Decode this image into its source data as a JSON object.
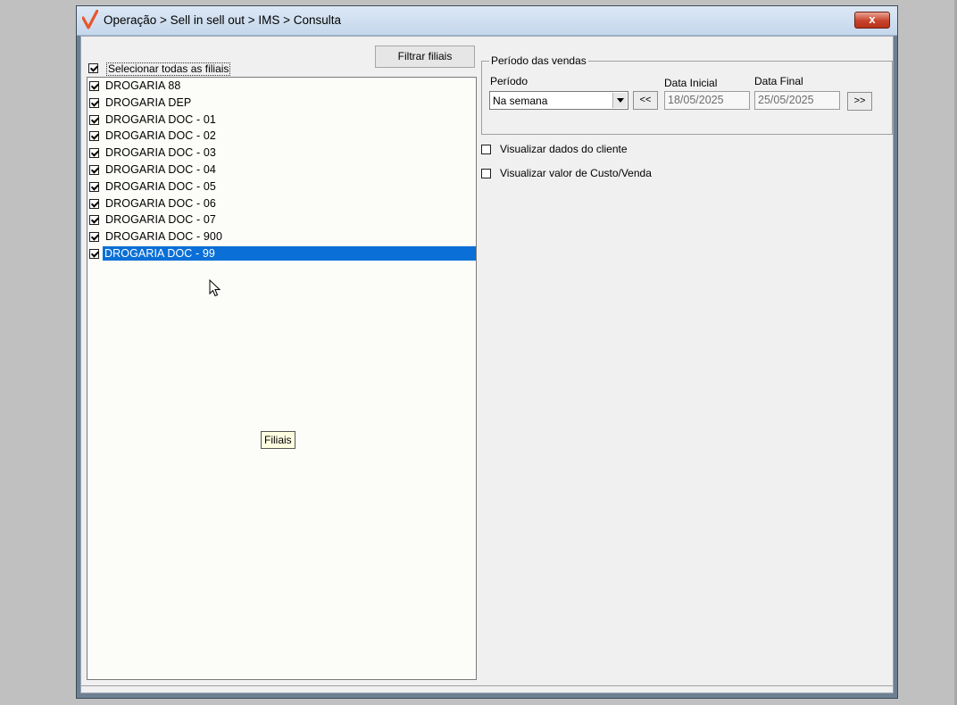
{
  "window": {
    "title": "Operação > Sell in sell out > IMS > Consulta",
    "close_label": "x"
  },
  "filiais": {
    "filter_button": "Filtrar filiais",
    "select_all_label": "Selecionar todas as filiais",
    "select_all_checked": true,
    "items": [
      {
        "label": "DROGARIA 88",
        "checked": true,
        "selected": false
      },
      {
        "label": "DROGARIA DEP",
        "checked": true,
        "selected": false
      },
      {
        "label": "DROGARIA DOC - 01",
        "checked": true,
        "selected": false
      },
      {
        "label": "DROGARIA DOC - 02",
        "checked": true,
        "selected": false
      },
      {
        "label": "DROGARIA DOC - 03",
        "checked": true,
        "selected": false
      },
      {
        "label": "DROGARIA DOC - 04",
        "checked": true,
        "selected": false
      },
      {
        "label": "DROGARIA DOC - 05",
        "checked": true,
        "selected": false
      },
      {
        "label": "DROGARIA DOC - 06",
        "checked": true,
        "selected": false
      },
      {
        "label": "DROGARIA DOC - 07",
        "checked": true,
        "selected": false
      },
      {
        "label": "DROGARIA DOC - 900",
        "checked": true,
        "selected": false
      },
      {
        "label": "DROGARIA DOC - 99",
        "checked": true,
        "selected": true
      }
    ],
    "tooltip": "Filiais"
  },
  "periodo": {
    "group_title": "Período das vendas",
    "periodo_label": "Período",
    "periodo_value": "Na semana",
    "prev_label": "<<",
    "next_label": ">>",
    "data_inicial_label": "Data Inicial",
    "data_inicial_value": "18/05/2025",
    "data_final_label": "Data Final",
    "data_final_value": "25/05/2025"
  },
  "options": {
    "visualizar_dados_cliente": "Visualizar dados do cliente",
    "visualizar_custo_venda": "Visualizar valor de Custo/Venda"
  },
  "colors": {
    "selection": "#0a6fd6",
    "app_icon": "#e8562a"
  }
}
